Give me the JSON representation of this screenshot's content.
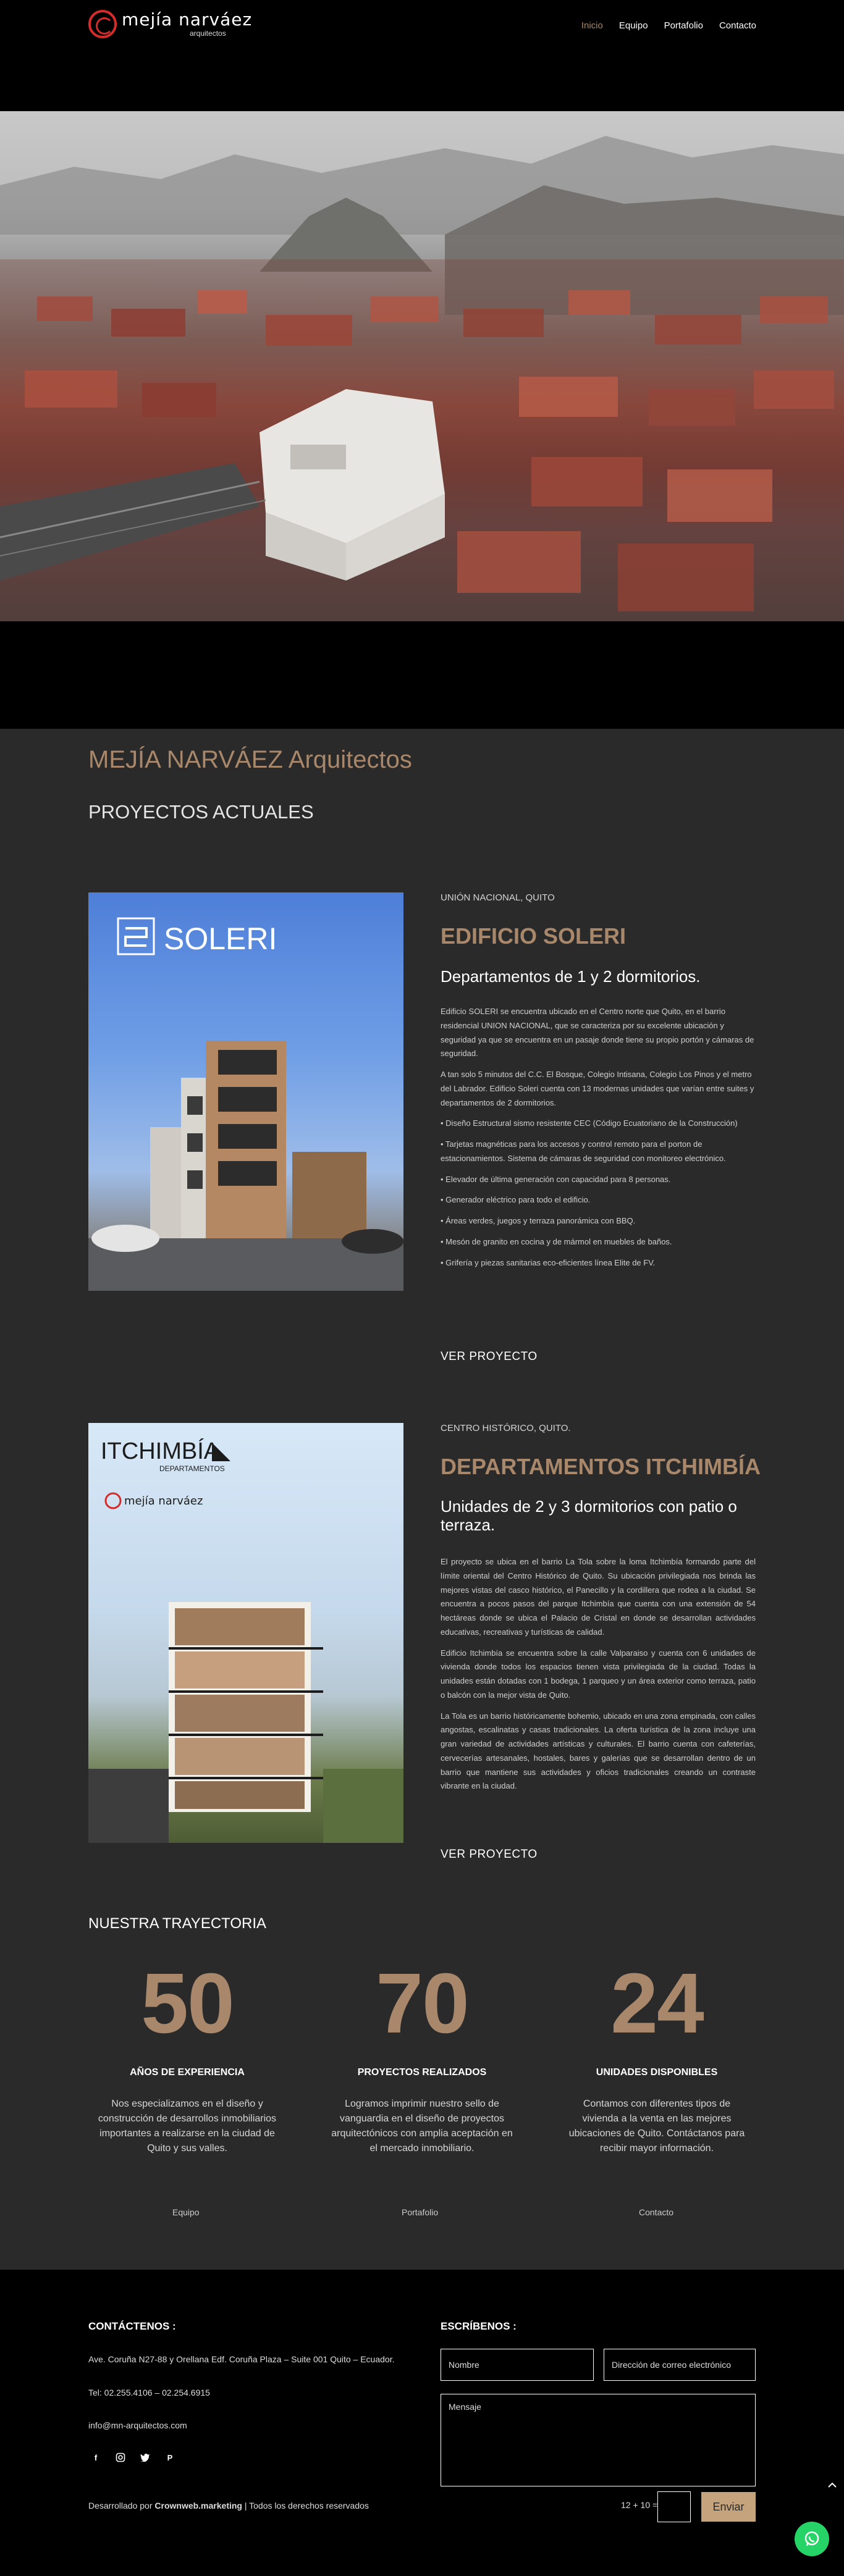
{
  "header": {
    "logo": {
      "name": "mejía narváez",
      "sub": "arquitectos"
    },
    "nav": [
      {
        "label": "Inicio",
        "active": true
      },
      {
        "label": "Equipo",
        "active": false
      },
      {
        "label": "Portafolio",
        "active": false
      },
      {
        "label": "Contacto",
        "active": false
      }
    ]
  },
  "intro": {
    "brand": "MEJÍA NARVÁEZ Arquitectos",
    "subtitle": "PROYECTOS ACTUALES"
  },
  "projects": [
    {
      "image_title": "SOLERI",
      "location": "UNIÓN NACIONAL, QUITO",
      "title": "EDIFICIO SOLERI",
      "subtitle": "Departamentos de 1 y 2 dormitorios.",
      "paragraphs": [
        "Edificio SOLERI se encuentra ubicado en el Centro norte que Quito, en el barrio residencial UNION NACIONAL, que se caracteriza por su excelente ubicación y seguridad ya que  se encuentra en un pasaje donde tiene su propio portón y cámaras de seguridad.",
        "A tan solo 5 minutos del C.C. El Bosque, Colegio Intisana, Colegio Los Pinos y el metro del Labrador. Edificio Soleri cuenta con 13 modernas unidades que varían entre suites y departamentos de 2 dormitorios.",
        "• Diseño Estructural sismo resistente CEC (Código Ecuatoriano de la Construcción)",
        "• Tarjetas magnéticas para los accesos y control remoto para el porton de estacionamientos. Sistema de cámaras de seguridad con monitoreo electrónico.",
        "• Elevador de última generación con capacidad para 8 personas.",
        "• Generador eléctrico para todo el edificio.",
        "• Áreas verdes, juegos y terraza panorámica con BBQ.",
        "• Mesón de granito en cocina y de mármol en muebles de baños.",
        "• Grifería y piezas sanitarias eco-eficientes línea Elite de FV."
      ],
      "link": "VER PROYECTO"
    },
    {
      "image_title": "ITCHIMBÍA",
      "image_sub": "DEPARTAMENTOS",
      "location": "CENTRO HISTÓRICO, QUITO.",
      "title": "DEPARTAMENTOS ITCHIMBÍA",
      "subtitle": "Unidades de 2 y 3 dormitorios con patio o terraza.",
      "paragraphs": [
        "El proyecto se ubica en el barrio La Tola sobre la loma Itchimbía formando parte del límite oriental del Centro Histórico de Quito. Su ubicación privilegiada nos brinda las mejores vistas del casco histórico, el Panecillo y la cordillera que rodea a la ciudad. Se encuentra a pocos pasos del parque Itchimbía que cuenta con una extensión de 54 hectáreas donde se ubica el Palacio de Cristal en donde se desarrollan actividades educativas, recreativas y turísticas de calidad.",
        "Edificio Itchimbía se encuentra sobre la calle Valparaiso y cuenta con 6 unidades de vivienda donde todos los espacios tienen vista privilegiada de la ciudad. Todas la unidades están dotadas con 1 bodega, 1 parqueo y un área exterior como terraza, patio o balcón con la mejor vista de Quito.",
        "La Tola es un barrio históricamente bohemio, ubicado en una zona empinada, con calles angostas, escalinatas y casas tradicionales. La oferta turística de la zona incluye una gran variedad de actividades artísticas y culturales. El barrio cuenta con cafeterías, cervecerías artesanales, hostales, bares y galerías que se desarrollan dentro de un barrio que mantiene sus actividades y oficios tradicionales creando un contraste vibrante en la ciudad."
      ],
      "link": "VER PROYECTO"
    }
  ],
  "trajectory": {
    "title": "NUESTRA TRAYECTORIA",
    "stats": [
      {
        "number": "50",
        "label": "AÑOS DE EXPERIENCIA",
        "desc": "Nos especializamos en el diseño y construcción de desarrollos inmobiliarios importantes a realizarse en la ciudad de Quito y sus valles."
      },
      {
        "number": "70",
        "label": "PROYECTOS REALIZADOS",
        "desc": "Logramos imprimir nuestro sello de vanguardia en el diseño de proyectos arquitectónicos con amplia aceptación en el mercado inmobiliario."
      },
      {
        "number": "24",
        "label": "UNIDADES DISPONIBLES",
        "desc": "Contamos con diferentes tipos de vivienda a la venta en las mejores ubicaciones de Quito.  Contáctanos para recibir mayor información."
      }
    ],
    "links": [
      "Equipo",
      "Portafolio",
      "Contacto"
    ]
  },
  "footer": {
    "contact_heading": "CONTÁCTENOS :",
    "address": "Ave. Coruña N27-88 y Orellana Edf. Coruña Plaza – Suite 001 Quito – Ecuador.",
    "phone": "Tel: 02.255.4106 – 02.254.6915",
    "email": "info@mn-arquitectos.com",
    "credit_prefix": "Desarrollado por",
    "credit_brand": "Crownweb.marketing",
    "credit_suffix": "| Todos los derechos reservados",
    "form_heading": "ESCRÍBENOS :",
    "name_placeholder": "Nombre",
    "email_placeholder": "Dirección de correo electrónico",
    "message_placeholder": "Mensaje",
    "captcha": "12 + 10 =",
    "send_label": "Enviar"
  },
  "colors": {
    "accent": "#a8876a",
    "dark": "#2a2a2a",
    "whatsapp": "#25d366",
    "logo": "#d52b2b"
  }
}
